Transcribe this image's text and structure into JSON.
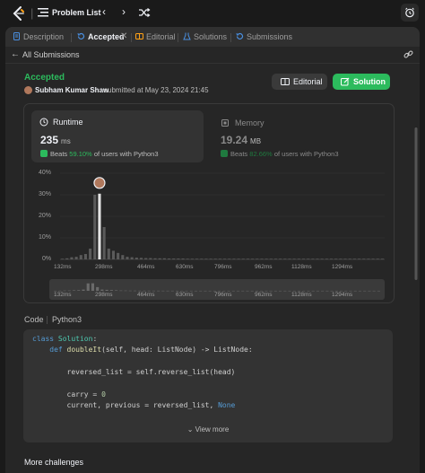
{
  "topbar": {
    "title": "Problem List",
    "prev": "‹",
    "next": "›"
  },
  "tabs": [
    {
      "label": "Description",
      "icon": "document-icon"
    },
    {
      "label": "Accepted",
      "icon": "history-icon",
      "active": true,
      "close": "✕"
    },
    {
      "label": "Editorial",
      "icon": "book-icon"
    },
    {
      "label": "Solutions",
      "icon": "flask-icon"
    },
    {
      "label": "Submissions",
      "icon": "history-icon"
    }
  ],
  "submission": {
    "back_label": "All Submissions",
    "status": "Accepted",
    "author": "Subham Kumar Shaw",
    "submitted_text": "submitted at May 23, 2024 21:45",
    "editorial_button": "Editorial",
    "solution_button": "Solution"
  },
  "runtime": {
    "title": "Runtime",
    "value": "235",
    "unit": "ms",
    "beats_prefix": "Beats",
    "beats_pct": "59.10%",
    "beats_suffix": "of users with Python3"
  },
  "memory": {
    "title": "Memory",
    "value": "19.24",
    "unit": "MB",
    "beats_prefix": "Beats",
    "beats_pct": "82.66%",
    "beats_suffix": "of users with Python3"
  },
  "colors": {
    "accent_green": "#2cbb5d",
    "bar_gray": "#5a5a5a",
    "bar_highlight": "#e5e5e5"
  },
  "chart_data": {
    "type": "bar",
    "ylabel_ticks": [
      "40%",
      "30%",
      "20%",
      "10%",
      "0%"
    ],
    "ylim": [
      0,
      40
    ],
    "x_tick_labels": [
      "132ms",
      "298ms",
      "464ms",
      "630ms",
      "796ms",
      "962ms",
      "1128ms",
      "1294ms"
    ],
    "highlight_index": 8,
    "values": [
      0.3,
      0.5,
      1.0,
      1.2,
      2.0,
      2.5,
      5.0,
      30.0,
      30.5,
      15.0,
      5.0,
      4.0,
      3.0,
      2.0,
      1.2,
      1.0,
      0.8,
      0.7,
      0.6,
      0.6,
      0.5,
      0.5,
      0.5,
      0.4,
      0.4,
      0.4,
      0.4,
      0.3,
      0.3,
      0.3,
      0.3,
      0.3,
      0.3,
      0.3,
      0.3,
      0.3,
      0.3,
      0.3,
      0.3,
      0.3,
      0.3,
      0.3,
      0.3,
      0.3,
      0.3,
      0.3,
      0.3,
      0.3,
      0.3,
      0.3,
      0.3,
      0.3,
      0.3,
      0.3,
      0.3,
      0.3,
      0.3,
      0.3,
      0.3,
      0.3,
      0.3,
      0.3,
      0.3,
      0.3,
      0.3,
      0.3,
      0.3,
      0.3,
      0.3,
      0.3
    ]
  },
  "code": {
    "label": "Code",
    "language": "Python3",
    "view_more": "View more",
    "lines": [
      [
        [
          "kw",
          "class "
        ],
        [
          "cls",
          "Solution"
        ],
        [
          "t",
          ":"
        ]
      ],
      [
        [
          "t",
          "    "
        ],
        [
          "kw",
          "def "
        ],
        [
          "fn",
          "doubleIt"
        ],
        [
          "t",
          "(self, head: ListNode) -> ListNode:"
        ]
      ],
      [
        [
          "t",
          ""
        ]
      ],
      [
        [
          "t",
          "        reversed_list = self.reverse_list(head)"
        ]
      ],
      [
        [
          "t",
          ""
        ]
      ],
      [
        [
          "t",
          "        carry = "
        ],
        [
          "nm",
          "0"
        ]
      ],
      [
        [
          "t",
          "        current, previous = reversed_list, "
        ],
        [
          "kw",
          "None"
        ]
      ]
    ]
  },
  "footer": {
    "more_challenges": "More challenges"
  }
}
